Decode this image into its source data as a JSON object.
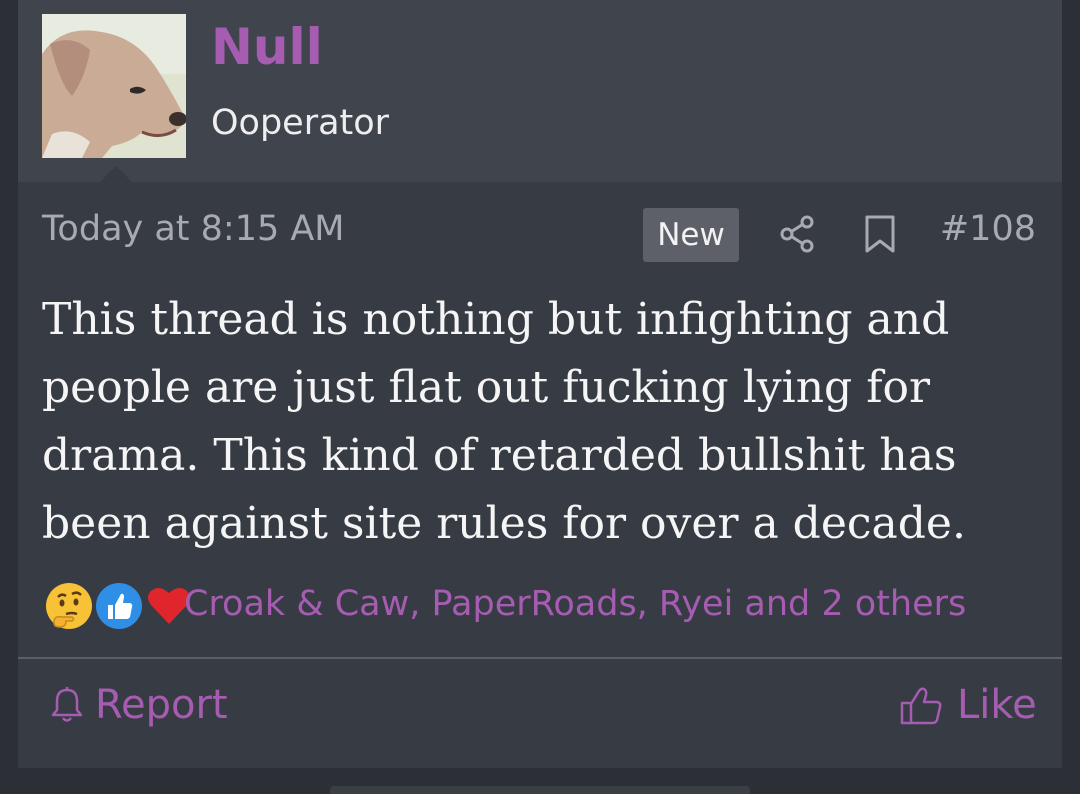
{
  "post": {
    "username": "Null",
    "user_title": "Ooperator",
    "timestamp": "Today at 8:15 AM",
    "new_badge": "New",
    "post_number": "#108",
    "message": "This thread is nothing but infighting and people are just flat out fucking lying for drama. This kind of retarded bullshit has been against site rules for over a decade.",
    "reactions": {
      "icons": [
        "thinking-face",
        "thumbs-up",
        "heart"
      ],
      "summary": "Croak & Caw, PaperRoads, Ryei and 2 others"
    },
    "actions": {
      "report_label": "Report",
      "like_label": "Like"
    }
  },
  "colors": {
    "accent": "#a65cb1",
    "post_background": "#373b44",
    "header_background": "#40444d",
    "meta_text": "#a7aab1",
    "body_text": "#f5f5f5"
  }
}
